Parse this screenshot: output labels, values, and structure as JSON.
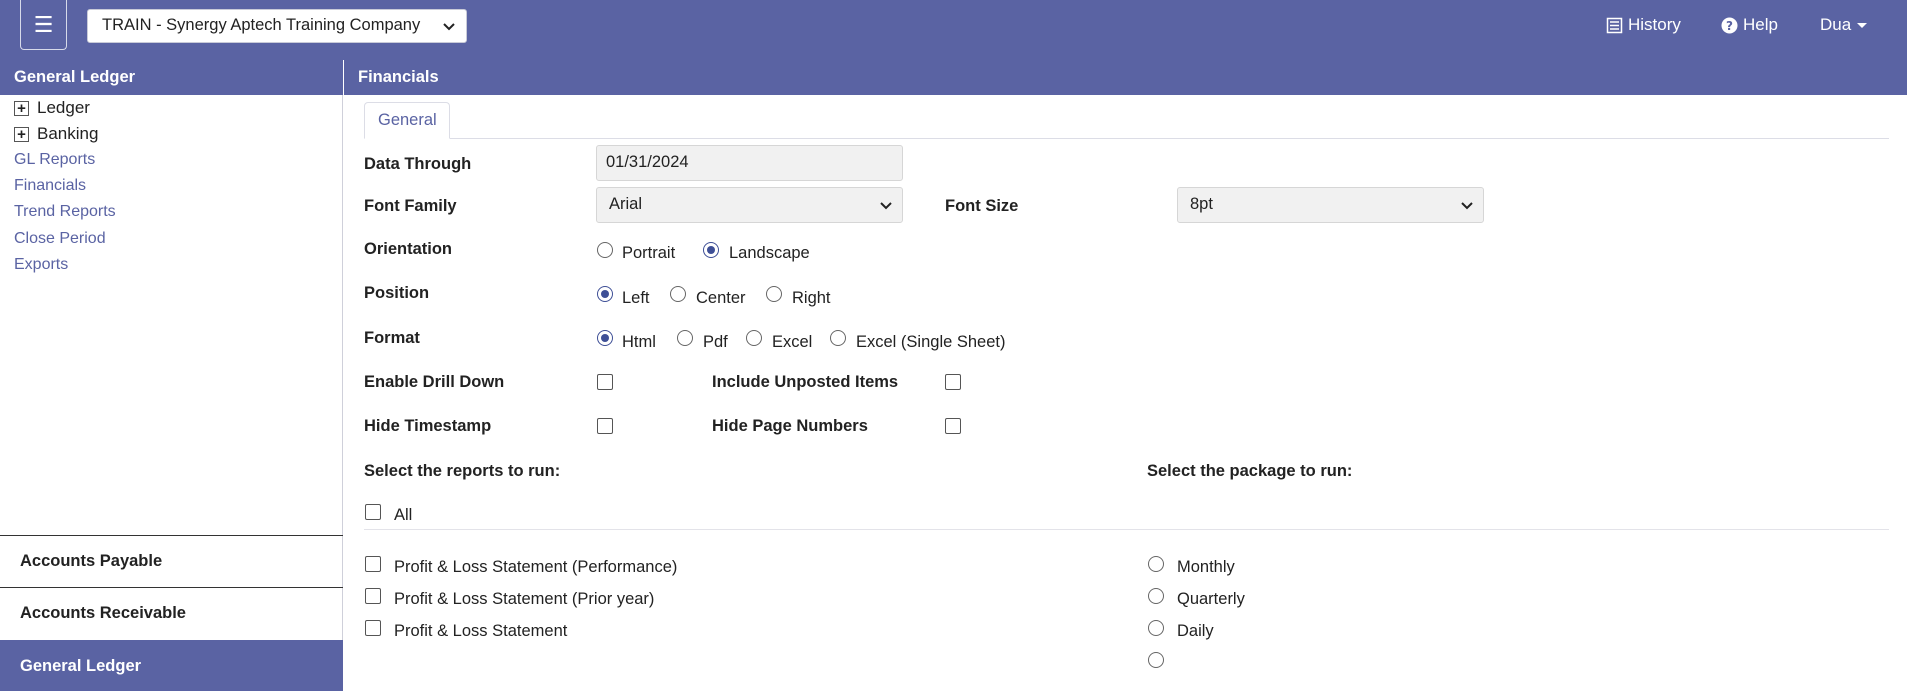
{
  "topbar": {
    "menu_icon": "hamburger-icon",
    "company": "TRAIN - Synergy Aptech Training Company",
    "history": "History",
    "help": "Help",
    "user": "Dua"
  },
  "sidebar": {
    "header": "General Ledger",
    "tree": [
      {
        "label": "Ledger"
      },
      {
        "label": "Banking"
      }
    ],
    "links": [
      "GL Reports",
      "Financials",
      "Trend Reports",
      "Close Period",
      "Exports"
    ],
    "modules": [
      {
        "label": "Accounts Payable"
      },
      {
        "label": "Accounts Receivable"
      },
      {
        "label": "General Ledger",
        "active": true
      }
    ]
  },
  "main": {
    "header": "Financials",
    "tab": "General",
    "data_through": {
      "label": "Data Through",
      "value": "01/31/2024"
    },
    "font_family": {
      "label": "Font Family",
      "value": "Arial"
    },
    "font_size": {
      "label": "Font Size",
      "value": "8pt"
    },
    "orientation": {
      "label": "Orientation",
      "options": [
        "Portrait",
        "Landscape"
      ],
      "selected": "Landscape"
    },
    "position": {
      "label": "Position",
      "options": [
        "Left",
        "Center",
        "Right"
      ],
      "selected": "Left"
    },
    "format": {
      "label": "Format",
      "options": [
        "Html",
        "Pdf",
        "Excel",
        "Excel (Single Sheet)"
      ],
      "selected": "Html"
    },
    "enable_drill_down": "Enable Drill Down",
    "include_unposted": "Include Unposted Items",
    "hide_timestamp": "Hide Timestamp",
    "hide_page_numbers": "Hide Page Numbers",
    "reports_label": "Select the reports to run:",
    "package_label": "Select the package to run:",
    "all_label": "All",
    "reports": [
      "Profit & Loss Statement (Performance)",
      "Profit & Loss Statement (Prior year)",
      "Profit & Loss Statement"
    ],
    "packages": [
      "Monthly",
      "Quarterly",
      "Daily",
      ""
    ]
  },
  "colors": {
    "brand": "#5a63a3",
    "radio_selected": "#3e4f96"
  }
}
